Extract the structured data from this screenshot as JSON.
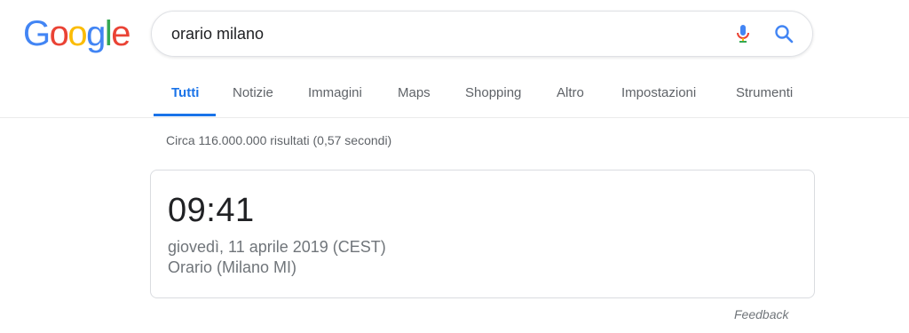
{
  "logo": {
    "letters": [
      "G",
      "o",
      "o",
      "g",
      "l",
      "e"
    ],
    "colors": [
      "#4285F4",
      "#EA4335",
      "#FBBC05",
      "#4285F4",
      "#34A853",
      "#EA4335"
    ]
  },
  "search": {
    "query": "orario milano",
    "icons": [
      "microphone-icon",
      "search-icon"
    ]
  },
  "tabs": [
    {
      "label": "Tutti",
      "active": true
    },
    {
      "label": "Notizie"
    },
    {
      "label": "Immagini"
    },
    {
      "label": "Maps"
    },
    {
      "label": "Shopping"
    },
    {
      "label": "Altro"
    },
    {
      "label": "Impostazioni"
    },
    {
      "label": "Strumenti"
    }
  ],
  "results": {
    "stats": "Circa 116.000.000 risultati (0,57 secondi)"
  },
  "clock_card": {
    "time": "09:41",
    "date": "giovedì, 11 aprile 2019 (CEST)",
    "location": "Orario (Milano MI)"
  },
  "feedback": "Feedback",
  "colors": {
    "accent": "#1a73e8",
    "text_secondary": "#70757a"
  }
}
